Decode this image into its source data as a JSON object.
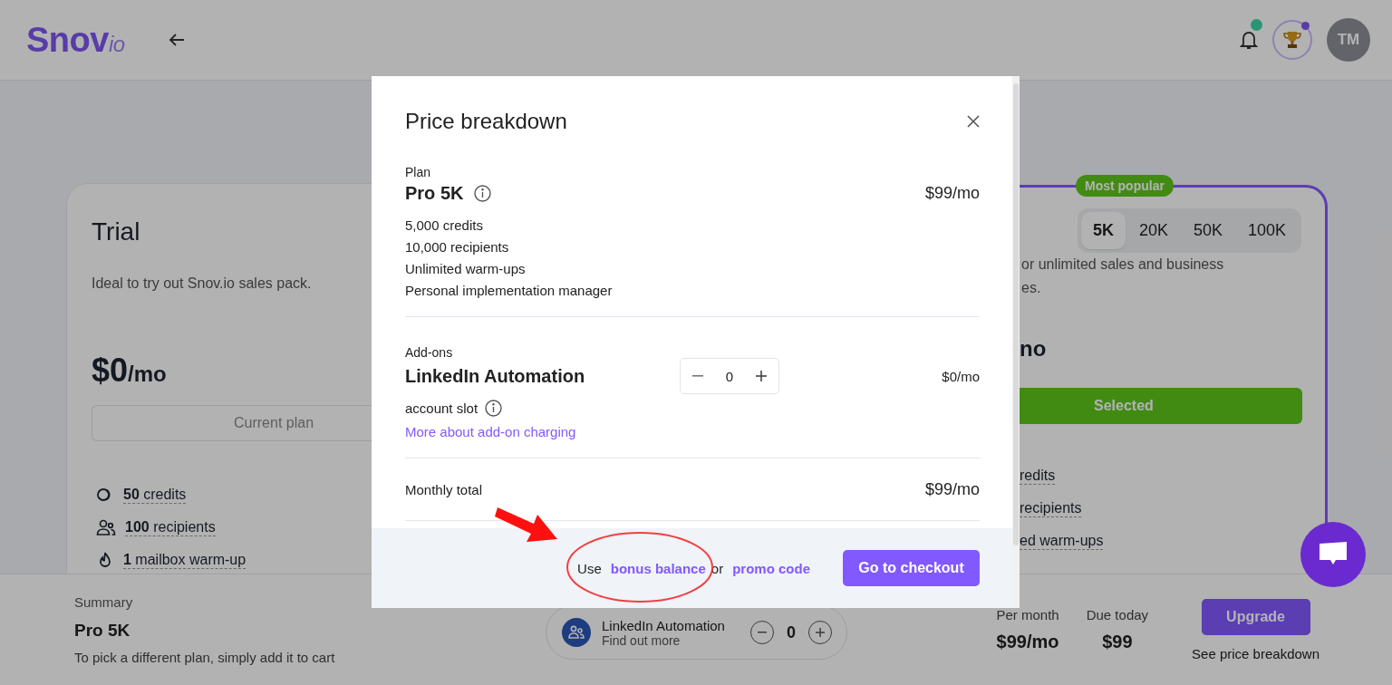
{
  "header": {
    "logo": "Snov",
    "logo_suffix": "io",
    "avatar_initials": "TM"
  },
  "plans": [
    {
      "kind": "trial",
      "title": "Trial",
      "description": "Ideal to try out Snov.io sales pack.",
      "price": "$0",
      "price_unit": "/mo",
      "button": "Current plan",
      "features": [
        {
          "text": "**50** credits"
        },
        {
          "text": "**100** recipients"
        },
        {
          "text": "**1** mailbox warm-up"
        }
      ]
    },
    {
      "kind": "pro",
      "badge": "Most popular",
      "tiers": [
        {
          "label": "5K",
          "selected": true
        },
        {
          "label": "20K",
          "selected": false
        },
        {
          "label": "50K",
          "selected": false
        },
        {
          "label": "100K",
          "selected": false
        }
      ],
      "description_lines": [
        "or unlimited sales and business",
        "es."
      ],
      "price_fragment": "no",
      "button": "Selected",
      "features": [
        {
          "text": "redits"
        },
        {
          "text": "recipients"
        },
        {
          "text": "ed warm-ups"
        }
      ]
    }
  ],
  "modal": {
    "title": "Price breakdown",
    "plan": {
      "heading": "Plan",
      "name": "Pro 5K",
      "price": "$99/mo",
      "features": [
        "5,000 credits",
        "10,000 recipients",
        "Unlimited warm-ups",
        "Personal implementation manager"
      ]
    },
    "addons": {
      "heading": "Add-ons",
      "items": [
        {
          "name": "LinkedIn Automation",
          "unit": "account slot",
          "quantity": "0",
          "price": "$0/mo"
        }
      ],
      "link": "More about add-on charging"
    },
    "total": {
      "label": "Monthly total",
      "price": "$99/mo"
    },
    "footer": {
      "prefix": "Use",
      "bonus_link": "bonus balance",
      "joiner": "or",
      "promo_link": "promo code",
      "checkout": "Go to checkout"
    }
  },
  "summary_bar": {
    "heading": "Summary",
    "plan": "Pro 5K",
    "hint": "To pick a different plan, simply add it to cart",
    "addon": {
      "name": "LinkedIn Automation",
      "link": "Find out more",
      "quantity": "0"
    },
    "per_month": {
      "label": "Per month",
      "value": "$99/mo"
    },
    "due_today": {
      "label": "Due today",
      "value": "$99"
    },
    "upgrade": "Upgrade",
    "breakdown_link": "See price breakdown"
  }
}
